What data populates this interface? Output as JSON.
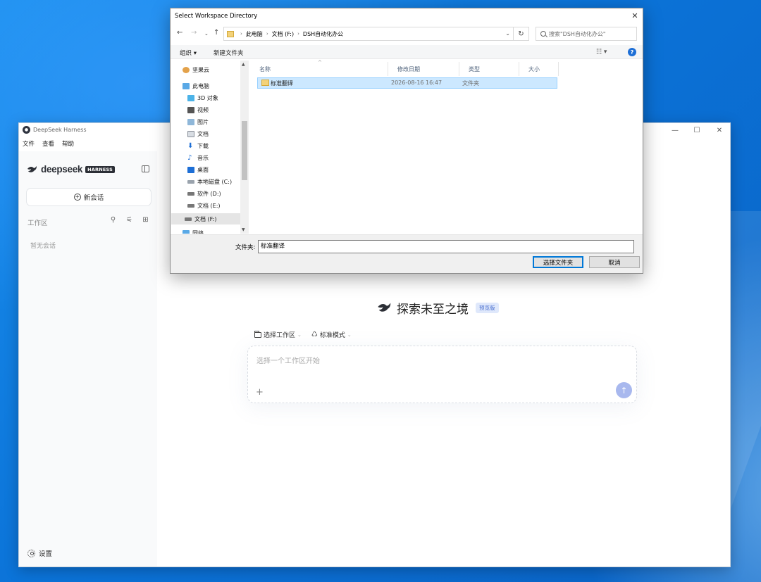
{
  "app": {
    "title": "DeepSeek Harness",
    "menu": [
      "文件",
      "查看",
      "帮助"
    ],
    "brand_word": "deepseek",
    "brand_badge": "HARNESS",
    "new_chat_label": "新会话",
    "workspace_label": "工作区",
    "empty_sessions": "暂无会话",
    "settings_label": "设置",
    "hero_title": "探索未至之境",
    "preview_badge": "预览版",
    "workspace_selector": "选择工作区",
    "mode_selector": "标准模式",
    "prompt_placeholder": "选择一个工作区开始",
    "colors": {
      "send_button": "#a8b8ee",
      "preview_badge_bg": "#dfe8fb",
      "accent": "#4a6fd0"
    }
  },
  "dialog": {
    "title": "Select Workspace Directory",
    "breadcrumb": [
      "此电脑",
      "文档 (F:)",
      "DSH自动化办公"
    ],
    "search_placeholder": "搜索\"DSH自动化办公\"",
    "organize_label": "组织 ▾",
    "new_folder_label": "新建文件夹",
    "tree": [
      {
        "label": "坚果云",
        "icon": "nutstore-icon"
      },
      {
        "label": "此电脑",
        "icon": "computer-icon"
      },
      {
        "label": "3D 对象",
        "icon": "3d-objects-icon"
      },
      {
        "label": "视频",
        "icon": "video-icon"
      },
      {
        "label": "图片",
        "icon": "pictures-icon"
      },
      {
        "label": "文档",
        "icon": "documents-icon"
      },
      {
        "label": "下载",
        "icon": "download-icon"
      },
      {
        "label": "音乐",
        "icon": "music-icon"
      },
      {
        "label": "桌面",
        "icon": "desktop-icon"
      },
      {
        "label": "本地磁盘 (C:)",
        "icon": "drive-icon"
      },
      {
        "label": "软件 (D:)",
        "icon": "drive-icon"
      },
      {
        "label": "文档 (E:)",
        "icon": "drive-icon"
      },
      {
        "label": "文档 (F:)",
        "icon": "drive-icon",
        "selected": true
      },
      {
        "label": "网络",
        "icon": "network-icon"
      }
    ],
    "columns": [
      "名称",
      "修改日期",
      "类型",
      "大小"
    ],
    "files": [
      {
        "name": "标准翻译",
        "modified": "2026-08-16 16:47",
        "type": "文件夹",
        "size": ""
      }
    ],
    "folder_label": "文件夹:",
    "folder_value": "标准翻译",
    "select_button": "选择文件夹",
    "cancel_button": "取消"
  }
}
